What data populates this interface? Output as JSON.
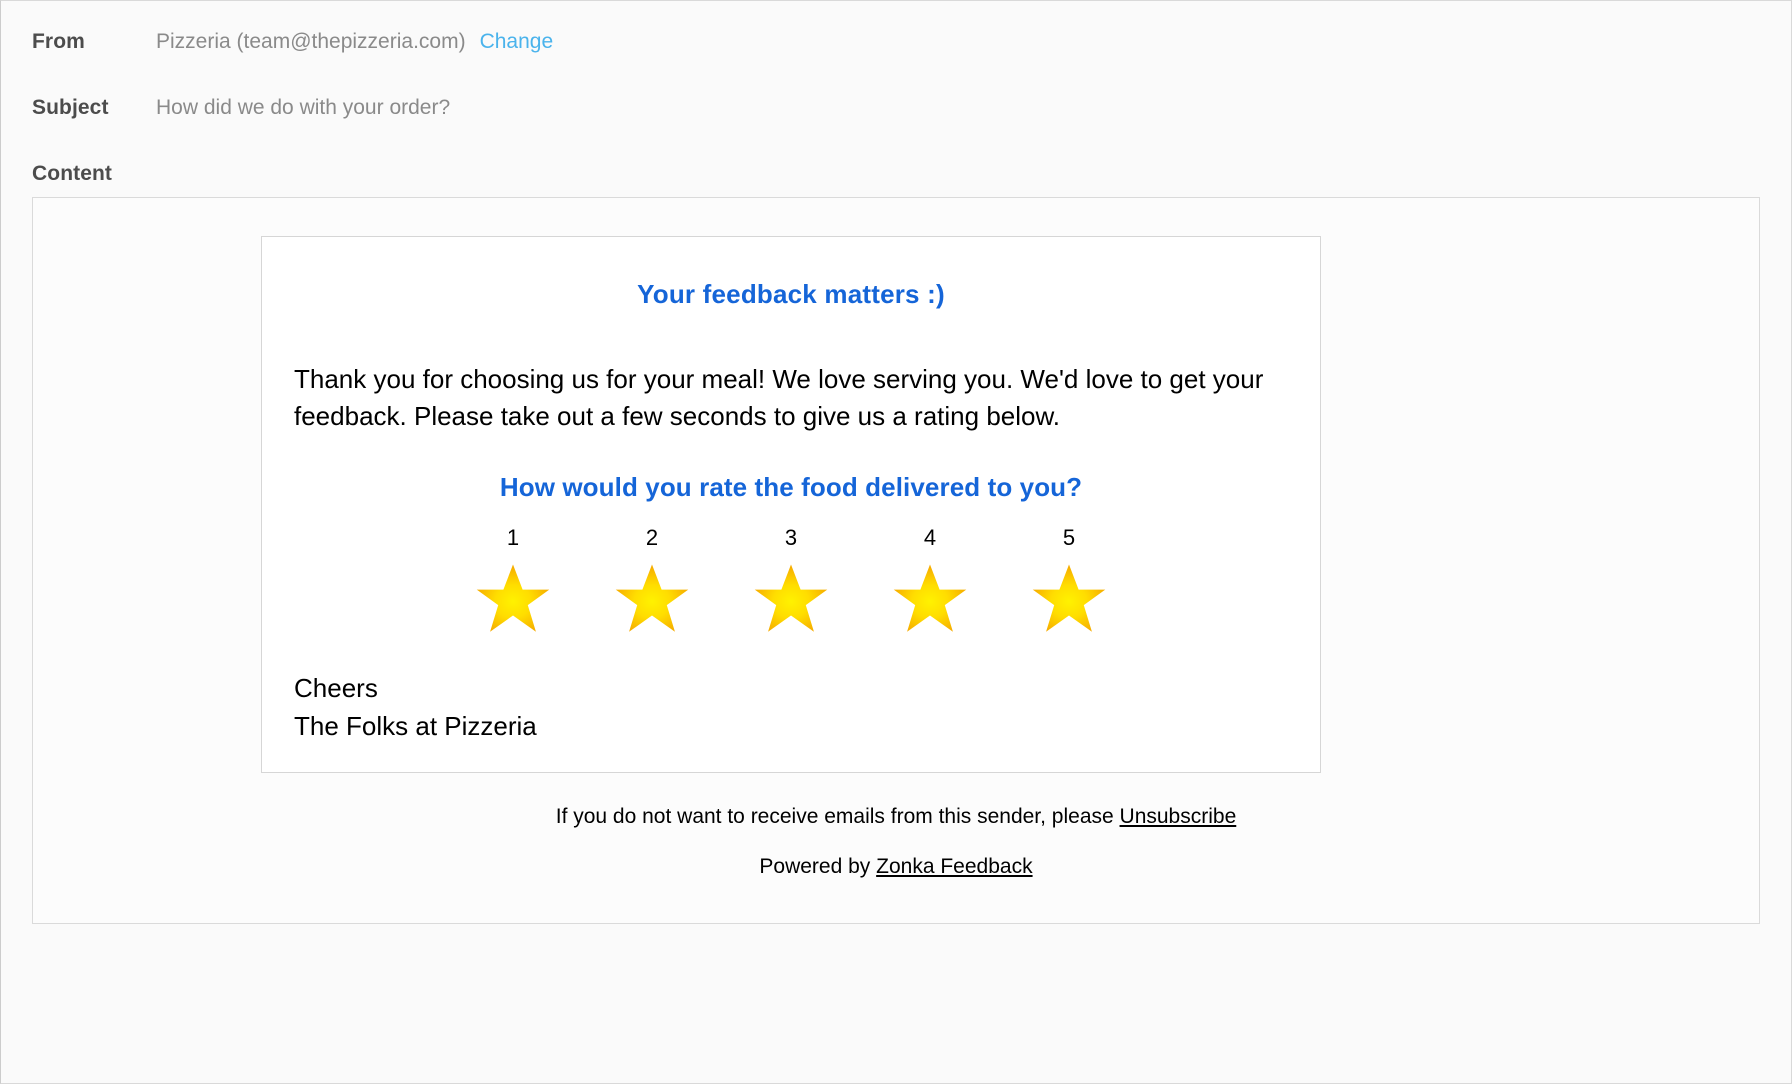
{
  "form": {
    "from": {
      "label": "From",
      "value": "Pizzeria (team@thepizzeria.com)",
      "change_label": "Change"
    },
    "subject": {
      "label": "Subject",
      "value": "How did we do with your order?"
    },
    "content": {
      "label": "Content"
    }
  },
  "email": {
    "heading": "Your feedback matters :)",
    "body": "Thank you for choosing us for your meal! We love serving you. We'd love to get your feedback. Please take out a few seconds to give us a rating below.",
    "question": "How would you rate the food delivered to you?",
    "rating": {
      "scale": [
        {
          "number": "1",
          "icon": "star-icon"
        },
        {
          "number": "2",
          "icon": "star-icon"
        },
        {
          "number": "3",
          "icon": "star-icon"
        },
        {
          "number": "4",
          "icon": "star-icon"
        },
        {
          "number": "5",
          "icon": "star-icon"
        }
      ]
    },
    "signature_line1": "Cheers",
    "signature_line2": "The Folks at Pizzeria",
    "footer": {
      "unsubscribe_text": "If you do not want to receive emails from this sender, please ",
      "unsubscribe_link": "Unsubscribe",
      "powered_text": "Powered by ",
      "powered_link": "Zonka Feedback"
    }
  },
  "colors": {
    "accent_blue": "#1565d8",
    "link_blue": "#4ab3ec",
    "label_gray": "#4c4c4c",
    "value_gray": "#8a8a8a",
    "star_center": "#FFF000",
    "star_mid": "#FFD400",
    "star_edge": "#F5A800",
    "panel_bg": "#fafafa",
    "card_bg": "#ffffff"
  }
}
